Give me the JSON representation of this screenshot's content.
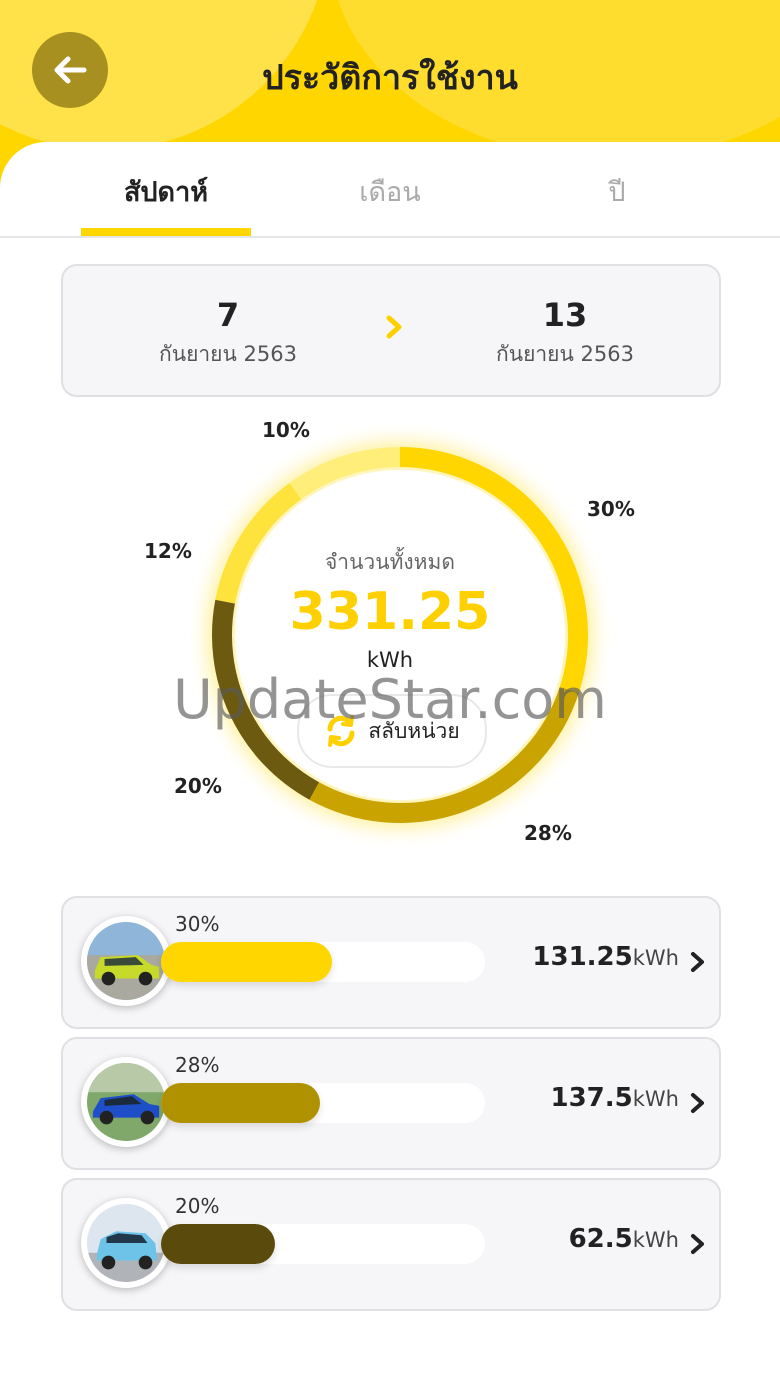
{
  "header": {
    "title": "ประวัติการใช้งาน",
    "back_icon": "arrow-left-icon"
  },
  "tabs": [
    {
      "label": "สัปดาห์",
      "active": true
    },
    {
      "label": "เดือน",
      "active": false
    },
    {
      "label": "ปี",
      "active": false
    }
  ],
  "date_range": {
    "start": {
      "day": "7",
      "month": "กันยายน 2563"
    },
    "end": {
      "day": "13",
      "month": "กันยายน 2563"
    }
  },
  "summary": {
    "title": "จำนวนทั้งหมด",
    "value": "331.25",
    "unit": "kWh",
    "toggle_label": "สลับหน่วย",
    "toggle_icon": "refresh-icon"
  },
  "chart_data": {
    "type": "pie",
    "slices": [
      {
        "label": "30%",
        "value": 30,
        "color": "#FFD600"
      },
      {
        "label": "28%",
        "value": 28,
        "color": "#C9A400"
      },
      {
        "label": "20%",
        "value": 20,
        "color": "#6B5A10"
      },
      {
        "label": "12%",
        "value": 12,
        "color": "#FFE33D"
      },
      {
        "label": "10%",
        "value": 10,
        "color": "#FFEE7A"
      }
    ]
  },
  "watermark": "UpdateStar.com",
  "cars": [
    {
      "percent": "30%",
      "fraction": 0.3,
      "value": "131.25",
      "unit": "kWh",
      "color": "#FFD600",
      "image": "yellow-green-suv"
    },
    {
      "percent": "28%",
      "fraction": 0.28,
      "value": "137.5",
      "unit": "kWh",
      "color": "#B09200",
      "image": "blue-suv"
    },
    {
      "percent": "20%",
      "fraction": 0.2,
      "value": "62.5",
      "unit": "kWh",
      "color": "#5A4B0C",
      "image": "light-blue-suv"
    }
  ]
}
